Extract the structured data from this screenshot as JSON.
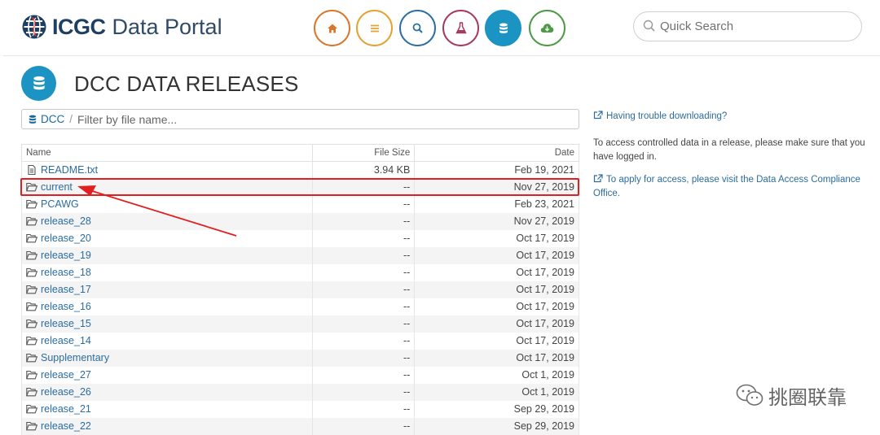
{
  "header": {
    "logo_bold": "ICGC",
    "logo_light": "Data Portal",
    "nav": [
      {
        "icon": "home-icon",
        "color": "#d9762d"
      },
      {
        "icon": "list-icon",
        "color": "#e4a331"
      },
      {
        "icon": "search-icon",
        "color": "#2a6ea4"
      },
      {
        "icon": "flask-icon",
        "color": "#a53a5c"
      },
      {
        "icon": "database-icon",
        "color": "#1b93c3",
        "active": true
      },
      {
        "icon": "cloud-download-icon",
        "color": "#4d9a45"
      }
    ],
    "search_placeholder": "Quick Search"
  },
  "page": {
    "title": "DCC DATA RELEASES",
    "breadcrumb_root": "DCC",
    "breadcrumb_sep": "/",
    "filter_placeholder": "Filter by file name..."
  },
  "table": {
    "columns": [
      "Name",
      "File Size",
      "Date"
    ],
    "rows": [
      {
        "name": "README.txt",
        "type": "file",
        "size": "3.94 KB",
        "date": "Feb 19, 2021"
      },
      {
        "name": "current",
        "type": "folder",
        "size": "--",
        "date": "Nov 27, 2019"
      },
      {
        "name": "PCAWG",
        "type": "folder",
        "size": "--",
        "date": "Feb 23, 2021"
      },
      {
        "name": "release_28",
        "type": "folder",
        "size": "--",
        "date": "Nov 27, 2019"
      },
      {
        "name": "release_20",
        "type": "folder",
        "size": "--",
        "date": "Oct 17, 2019"
      },
      {
        "name": "release_19",
        "type": "folder",
        "size": "--",
        "date": "Oct 17, 2019"
      },
      {
        "name": "release_18",
        "type": "folder",
        "size": "--",
        "date": "Oct 17, 2019"
      },
      {
        "name": "release_17",
        "type": "folder",
        "size": "--",
        "date": "Oct 17, 2019"
      },
      {
        "name": "release_16",
        "type": "folder",
        "size": "--",
        "date": "Oct 17, 2019"
      },
      {
        "name": "release_15",
        "type": "folder",
        "size": "--",
        "date": "Oct 17, 2019"
      },
      {
        "name": "release_14",
        "type": "folder",
        "size": "--",
        "date": "Oct 17, 2019"
      },
      {
        "name": "Supplementary",
        "type": "folder",
        "size": "--",
        "date": "Oct 17, 2019"
      },
      {
        "name": "release_27",
        "type": "folder",
        "size": "--",
        "date": "Oct 1, 2019"
      },
      {
        "name": "release_26",
        "type": "folder",
        "size": "--",
        "date": "Oct 1, 2019"
      },
      {
        "name": "release_21",
        "type": "folder",
        "size": "--",
        "date": "Sep 29, 2019"
      },
      {
        "name": "release_22",
        "type": "folder",
        "size": "--",
        "date": "Sep 29, 2019"
      }
    ]
  },
  "side": {
    "trouble_link": "Having trouble downloading?",
    "controlled_text": "To access controlled data in a release, please make sure that you have logged in.",
    "apply_link": "To apply for access, please visit the Data Access Compliance Office."
  },
  "annotation": {
    "color": "#e02020"
  },
  "watermark": {
    "text": "挑圈联靠"
  }
}
